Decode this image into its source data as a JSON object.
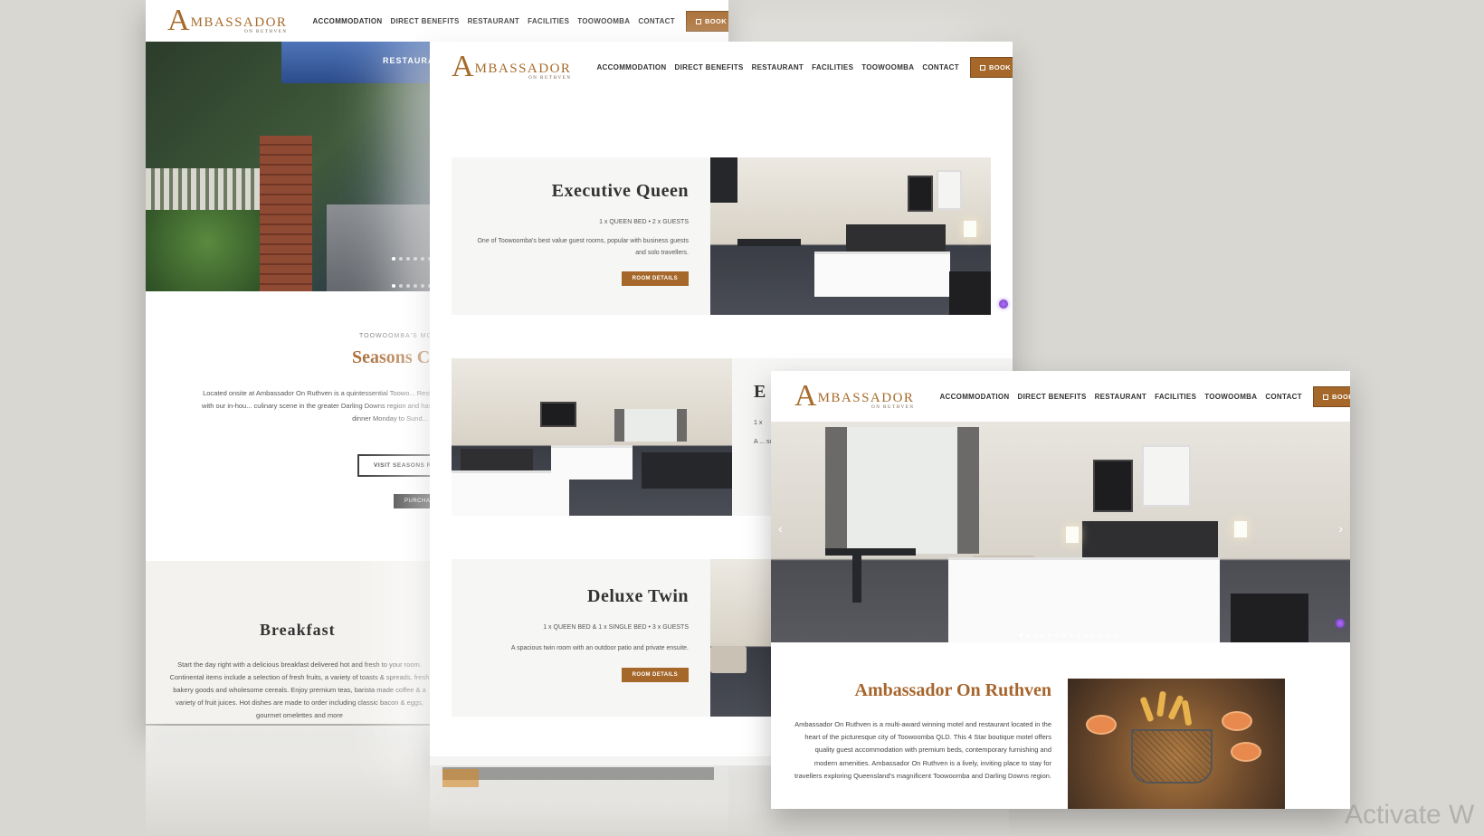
{
  "brand": {
    "logo_initial": "A",
    "logo_name": "MBASSADOR",
    "logo_sub": "ON RUTHVEN"
  },
  "nav": {
    "items": [
      "ACCOMMODATION",
      "DIRECT BENEFITS",
      "RESTAURANT",
      "FACILITIES",
      "TOOWOOMBA",
      "CONTACT"
    ],
    "book_label": "BOOK DIRECT"
  },
  "restaurant_page": {
    "canopy_label": "RESTAURANT",
    "kicker": "TOOWOOMBA'S MO",
    "title": "Seasons C",
    "body": "Located onsite at Ambassador On Ruthven is a quintessential Toowo... Restaurant is equally adored by locals as it is popular with our in-hou... culinary scene in the greater Darling Downs region and has a long repu... service. The restaurant is open for dinner Monday to Sund...",
    "visit_button": "VISIT SEASONS R",
    "purchase_button": "PURCHA",
    "breakfast_title": "Breakfast",
    "breakfast_body": "Start the day right with a delicious breakfast delivered hot and fresh to your room. Continental items include a selection of fresh fruits, a variety of toasts & spreads, fresh bakery goods and wholesome cereals. Enjoy premium teas, barista made coffee & a variety of fruit juices. Hot dishes are made to order including classic bacon & eggs, gourmet omelettes and more"
  },
  "rooms_page": {
    "rooms": [
      {
        "title": "Executive Queen",
        "spec": "1 x QUEEN BED • 2 x GUESTS",
        "desc": "One of Toowoomba's best value guest rooms, popular with business guests and solo travellers.",
        "button": "ROOM DETAILS"
      },
      {
        "title": "E",
        "spec": "1 x",
        "desc": "A ... sol..."
      },
      {
        "title": "Deluxe Twin",
        "spec": "1 x QUEEN BED & 1 x SINGLE BED • 3 x GUESTS",
        "desc": "A spacious twin room with an outdoor patio and private ensuite.",
        "button": "ROOM DETAILS"
      }
    ]
  },
  "home_page": {
    "about_title": "Ambassador On Ruthven",
    "about_body": "Ambassador On Ruthven is a multi-award winning motel and restaurant located in the heart of the picturesque city of Toowoomba QLD. This 4 Star boutique motel offers quality guest accommodation with premium beds, contemporary furnishing and modern amenities. Ambassador On Ruthven is a lively, inviting place to stay for travellers exploring Queensland's magnificent Toowoomba and Darling Downs region.",
    "prev_arrow": "‹",
    "next_arrow": "›"
  },
  "watermark": "Activate W",
  "colors": {
    "accent": "#a5672a",
    "background": "#d9d7d2",
    "text": "#333333"
  }
}
